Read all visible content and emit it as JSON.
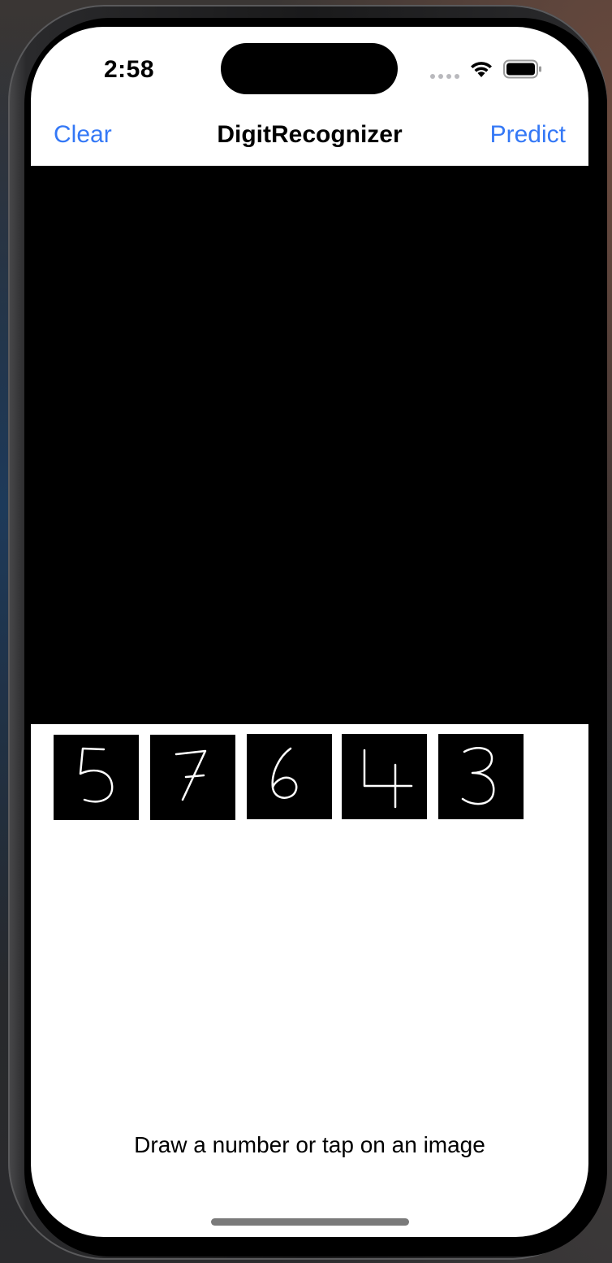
{
  "status_bar": {
    "time": "2:58",
    "icons": [
      "cellular-signal-icon",
      "wifi-icon",
      "battery-icon"
    ]
  },
  "nav_bar": {
    "left_button": "Clear",
    "title": "DigitRecognizer",
    "right_button": "Predict",
    "accent_color": "#3478f6"
  },
  "canvas": {
    "background_color": "#000000"
  },
  "samples": [
    {
      "digit": "5"
    },
    {
      "digit": "7"
    },
    {
      "digit": "6"
    },
    {
      "digit": "4"
    },
    {
      "digit": "3"
    }
  ],
  "hint": "Draw a number or tap on an image"
}
